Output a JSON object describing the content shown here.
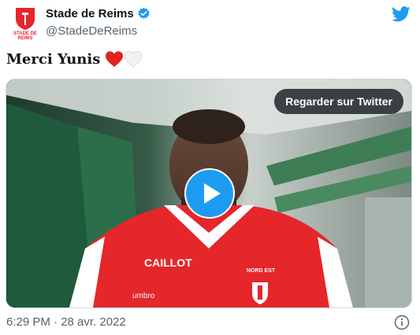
{
  "account": {
    "name": "Stade de Reims",
    "handle": "@StadeDeReims",
    "logo_text_line1": "STADE",
    "logo_text_line2": "DE",
    "logo_text_line3": "REIMS",
    "verified_icon": "verified-badge-icon"
  },
  "tweet": {
    "text": "Merci Yunis",
    "emojis": [
      "red-heart-icon",
      "white-heart-icon"
    ]
  },
  "media": {
    "watch_label": "Regarder sur Twitter",
    "play_icon": "play-icon",
    "sponsor_text": "CAILLOT",
    "kit_brand": "umbro",
    "bank_text": "NORD EST"
  },
  "footer": {
    "timestamp": "6:29 PM · 28 avr. 2022",
    "info_icon": "info-icon"
  },
  "colors": {
    "twitter_blue": "#1d9bf0",
    "reims_red": "#e5262a",
    "text_secondary": "#536471"
  }
}
